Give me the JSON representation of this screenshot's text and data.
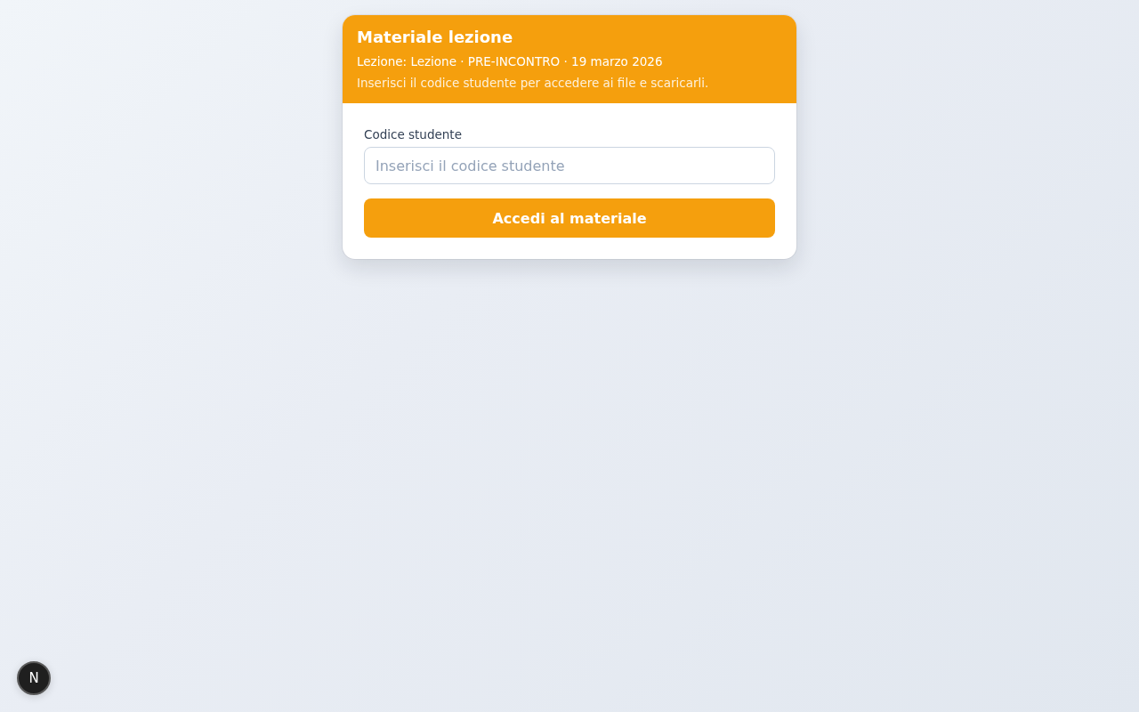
{
  "card": {
    "title": "Materiale lezione",
    "meta": "Lezione: Lezione · PRE-INCONTRO · 19 marzo 2026",
    "instructions": "Inserisci il codice studente per accedere ai file e scaricarli."
  },
  "form": {
    "label": "Codice studente",
    "placeholder": "Inserisci il codice studente",
    "submit": "Accedi al materiale"
  },
  "dev_indicator": {
    "label": "N"
  }
}
